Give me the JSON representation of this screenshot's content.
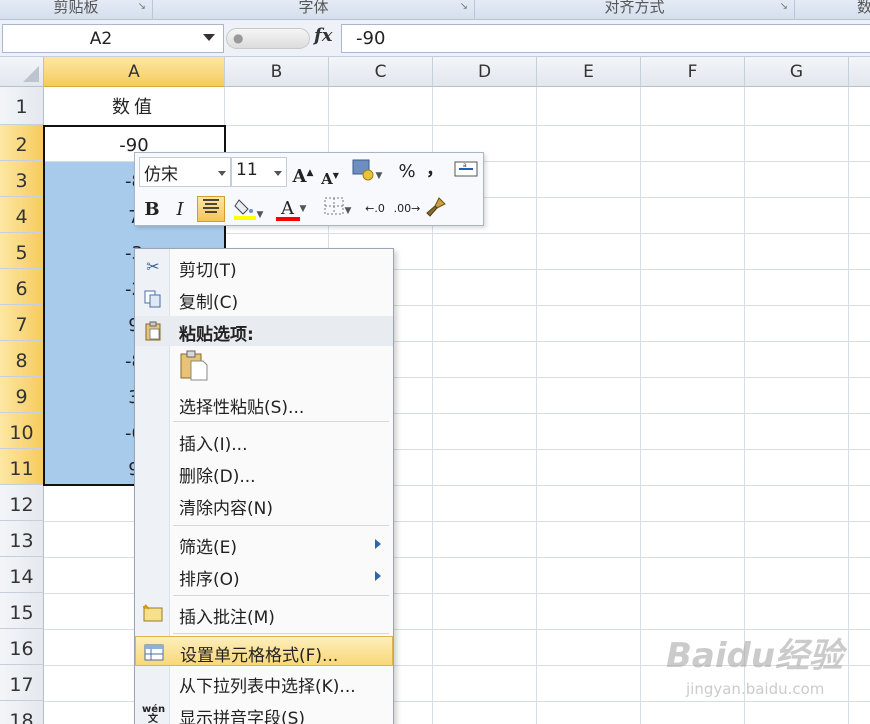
{
  "ribbon": {
    "groups": [
      "剪贴板",
      "字体",
      "对齐方式",
      "数"
    ]
  },
  "formula_bar": {
    "name_box": "A2",
    "fx_label": "fx",
    "value": "-90"
  },
  "columns": [
    "A",
    "B",
    "C",
    "D",
    "E",
    "F",
    "G"
  ],
  "rows": [
    "1",
    "2",
    "3",
    "4",
    "5",
    "6",
    "7",
    "8",
    "9",
    "10",
    "11",
    "12",
    "13",
    "14",
    "15",
    "16",
    "17",
    "18"
  ],
  "cells": {
    "A1": "数值",
    "A2": "-90",
    "A3": "-8",
    "A4": "7",
    "A5": "-3",
    "A6": "-2",
    "A7": "9",
    "A8": "-8",
    "A9": "3",
    "A10": "-6",
    "A11": "9"
  },
  "mini_toolbar": {
    "font": "仿宋",
    "size": "11",
    "grow_font": "A",
    "shrink_font": "A",
    "percent": "%",
    "comma": "，",
    "bold": "B",
    "italic": "I",
    "font_color": "A",
    "fill_color_hex": "#ffff00",
    "font_color_hex": "#ff0000"
  },
  "context_menu": {
    "items": [
      {
        "label": "剪切(T)",
        "icon": "scissors-icon"
      },
      {
        "label": "复制(C)",
        "icon": "copy-icon"
      },
      {
        "label": "粘贴选项:",
        "icon": "paste-icon"
      },
      {
        "label": "选择性粘贴(S)..."
      },
      {
        "label": "插入(I)..."
      },
      {
        "label": "删除(D)..."
      },
      {
        "label": "清除内容(N)"
      },
      {
        "label": "筛选(E)"
      },
      {
        "label": "排序(O)"
      },
      {
        "label": "插入批注(M)",
        "icon": "comment-icon"
      },
      {
        "label": "设置单元格格式(F)...",
        "icon": "format-cells-icon"
      },
      {
        "label": "从下拉列表中选择(K)..."
      },
      {
        "label": "显示拼音字段(S)",
        "icon": "phonetic-icon"
      }
    ],
    "paste_option_icon": "paste-clipboard-icon"
  },
  "watermark": {
    "brand": "Baidu经验",
    "url": "jingyan.baidu.com"
  }
}
